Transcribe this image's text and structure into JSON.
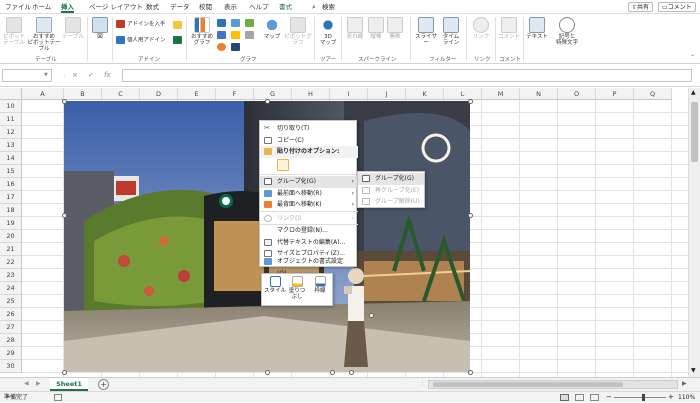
{
  "tabs": [
    "ファイル",
    "ホーム",
    "挿入",
    "ページ レイアウト",
    "数式",
    "データ",
    "校閲",
    "表示",
    "ヘルプ",
    "書式"
  ],
  "search": "検索",
  "share": "共有",
  "comment": "コメント",
  "ribbon": {
    "pivot": "ピボット\nテーブル",
    "rec_pivot": "おすすめ\nピボットテーブル",
    "table": "テーブル",
    "images": "図",
    "addin_get": "アドインを入手",
    "addin_personal": "個人用アドイン",
    "rec_chart": "おすすめ\nグラフ",
    "map": "マップ",
    "pivot_chart": "ピボットグラフ",
    "map3d": "3D\nマップ",
    "line": "折れ線",
    "column": "縦棒",
    "winloss": "勝敗",
    "slicer": "スライサー",
    "timeline": "タイム\nライン",
    "link": "リンク",
    "comment_btn": "コメント",
    "text": "テキスト",
    "symbol": "記号と\n特殊文字",
    "groups": {
      "table": "テーブル",
      "addins": "アドイン",
      "charts": "グラフ",
      "tours": "ツアー",
      "sparklines": "スパークライン",
      "filters": "フィルター",
      "links": "リンク",
      "comments": "コメント"
    }
  },
  "formula": {
    "fx": "fx",
    "cancel": "×",
    "enter": "✓"
  },
  "columns": [
    "A",
    "B",
    "C",
    "D",
    "E",
    "F",
    "G",
    "H",
    "I",
    "J",
    "K",
    "L",
    "M",
    "N",
    "O",
    "P",
    "Q"
  ],
  "rows": [
    "10",
    "11",
    "12",
    "13",
    "14",
    "15",
    "16",
    "17",
    "18",
    "19",
    "20",
    "21",
    "22",
    "23",
    "24",
    "25",
    "26",
    "27",
    "28",
    "29",
    "30"
  ],
  "context_menu": {
    "cut": "切り取り(T)",
    "copy": "コピー(C)",
    "paste_options": "貼り付けのオプション:",
    "group": "グループ化(G)",
    "bring_front": "最前面へ移動(R)",
    "send_back": "最背面へ移動(K)",
    "link": "リンク(I)",
    "macro": "マクロの登録(N)...",
    "alt_text": "代替テキストの編集(A)...",
    "size_props": "サイズとプロパティ(Z)...",
    "format_object": "オブジェクトの書式設定(O)..."
  },
  "submenu": {
    "group": "グループ化(G)",
    "regroup": "再グループ化(E)",
    "ungroup": "グループ解除(U)"
  },
  "mini_toolbar": {
    "style": "スタイル",
    "fill": "塗りつぶし",
    "outline": "枠線"
  },
  "sheet_tab": "Sheet1",
  "status": {
    "ready": "準備完了",
    "zoom": "110%"
  },
  "colors": {
    "accent": "#217346"
  }
}
